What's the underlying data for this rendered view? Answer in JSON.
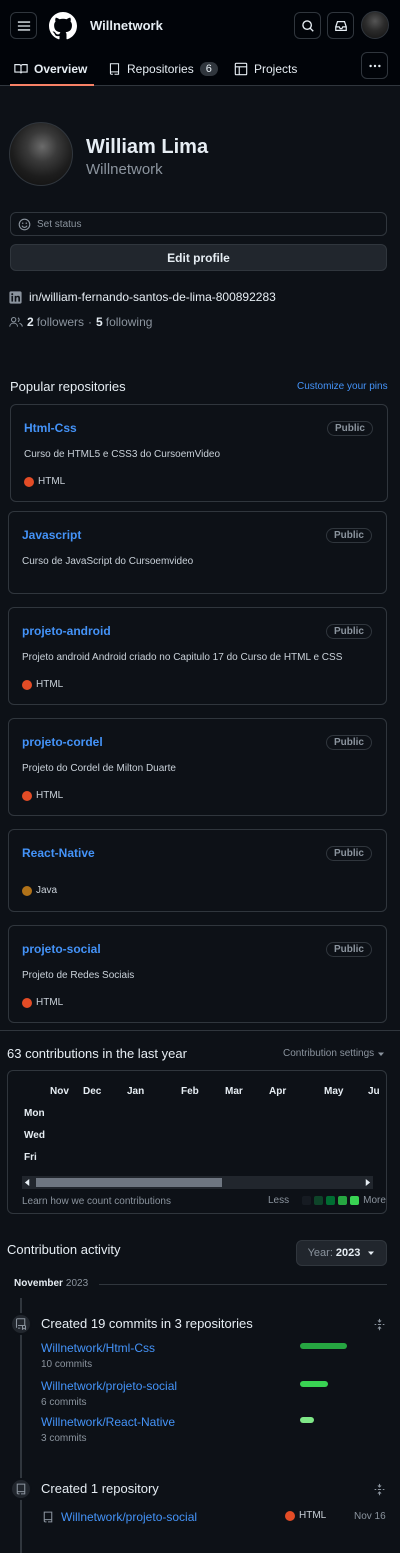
{
  "header": {
    "username": "Willnetwork",
    "tabs": [
      {
        "label": "Overview",
        "active": true
      },
      {
        "label": "Repositories",
        "count": "6"
      },
      {
        "label": "Projects"
      }
    ]
  },
  "profile": {
    "name": "William Lima",
    "login": "Willnetwork",
    "set_status": "Set status",
    "edit_profile": "Edit profile",
    "linkedin": "in/william-fernando-santos-de-lima-800892283",
    "followers_count": "2",
    "followers_label": "followers",
    "separator": "·",
    "following_count": "5",
    "following_label": "following"
  },
  "popular": {
    "title": "Popular repositories",
    "customize": "Customize your pins",
    "repos": [
      {
        "name": "Html-Css",
        "visibility": "Public",
        "description": "Curso de HTML5 e CSS3 do CursoemVideo",
        "language": "HTML",
        "language_color": "#e34c26"
      },
      {
        "name": "Javascript",
        "visibility": "Public",
        "description": "Curso de JavaScript do Cursoemvideo",
        "language": "",
        "language_color": ""
      },
      {
        "name": "projeto-android",
        "visibility": "Public",
        "description": "Projeto android Android criado no Capitulo 17 do Curso de HTML e CSS",
        "language": "HTML",
        "language_color": "#e34c26"
      },
      {
        "name": "projeto-cordel",
        "visibility": "Public",
        "description": "Projeto do Cordel de Milton Duarte",
        "language": "HTML",
        "language_color": "#e34c26"
      },
      {
        "name": "React-Native",
        "visibility": "Public",
        "description": "",
        "language": "Java",
        "language_color": "#b07219"
      },
      {
        "name": "projeto-social",
        "visibility": "Public",
        "description": "Projeto de Redes Sociais",
        "language": "HTML",
        "language_color": "#e34c26"
      }
    ]
  },
  "contributions": {
    "title": "63 contributions in the last year",
    "settings": "Contribution settings",
    "months": [
      "Nov",
      "Dec",
      "Jan",
      "Feb",
      "Mar",
      "Apr",
      "May",
      "Ju"
    ],
    "days": [
      "Mon",
      "Wed",
      "Fri"
    ],
    "learn": "Learn how we count contributions",
    "less": "Less",
    "more": "More",
    "legend_colors": [
      "#161b22",
      "#0e4429",
      "#006d32",
      "#26a641",
      "#39d353"
    ]
  },
  "activity": {
    "title": "Contribution activity",
    "year_label": "Year:",
    "year_value": "2023",
    "month": "November",
    "month_year": "2023",
    "commits_title": "Created 19 commits in 3 repositories",
    "commit_repos": [
      {
        "name": "Willnetwork/Html-Css",
        "commits": "10 commits",
        "fraction": 1.0
      },
      {
        "name": "Willnetwork/projeto-social",
        "commits": "6 commits",
        "fraction": 0.6
      },
      {
        "name": "Willnetwork/React-Native",
        "commits": "3 commits",
        "fraction": 0.3
      }
    ],
    "repo_title": "Created 1 repository",
    "created_repo": {
      "name": "Willnetwork/projeto-social",
      "language": "HTML",
      "language_color": "#e34c26",
      "date": "Nov 16"
    }
  }
}
